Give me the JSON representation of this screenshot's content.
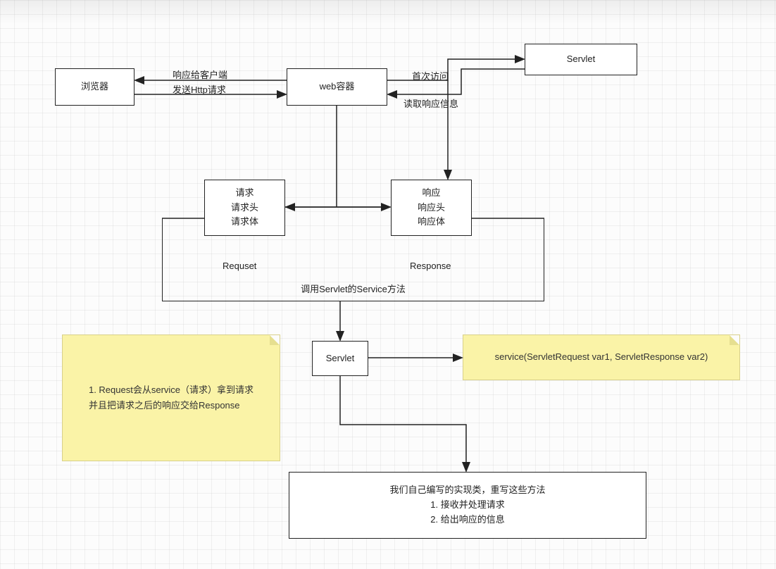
{
  "boxes": {
    "browser": "浏览器",
    "web_container": "web容器",
    "servlet_top": "Servlet",
    "request_box": [
      "请求",
      "请求头",
      "请求体"
    ],
    "response_box": [
      "响应",
      "响应头",
      "响应体"
    ],
    "servlet_mid": "Servlet",
    "impl_box": [
      "我们自己编写的实现类，重写这些方法",
      "1. 接收并处理请求",
      "2. 给出响应的信息"
    ]
  },
  "edge_labels": {
    "resp_to_client": "响应给客户端",
    "send_http": "发送Http请求",
    "first_visit": "首次访问",
    "read_resp": "读取响应信息",
    "request_lbl": "Requset",
    "response_lbl": "Response",
    "call_service": "调用Servlet的Service方法"
  },
  "notes": {
    "note1": [
      "1. Request会从service（请求）拿到请求",
      "并且把请求之后的响应交给Response"
    ],
    "note2": "service(ServletRequest var1, ServletResponse var2)"
  }
}
